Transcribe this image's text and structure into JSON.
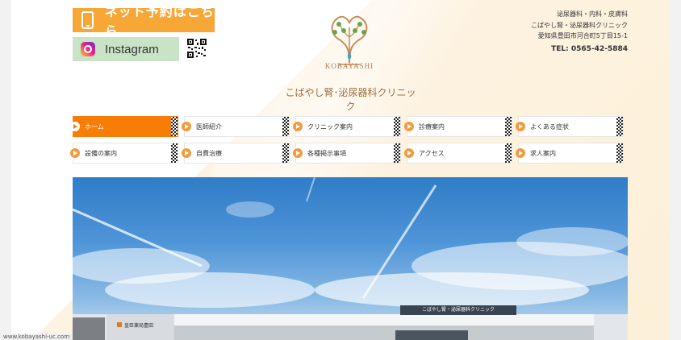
{
  "header": {
    "reserve_label": "ネット予約はこちら",
    "instagram_label": "Instagram",
    "logo_text": "KOBAYASHI",
    "clinic_name": "こばやし腎･泌尿器科クリニック",
    "address": {
      "line1": "泌尿器科・内科・皮膚科",
      "line2": "こばやし腎・泌尿器科クリニック",
      "line3": "愛知県豊田市河合町5丁目15-1",
      "tel": "TEL: 0565-42-5884"
    }
  },
  "nav": {
    "items": [
      {
        "label": "ホーム",
        "active": true
      },
      {
        "label": "医師紹介"
      },
      {
        "label": "クリニック案内"
      },
      {
        "label": "診療案内"
      },
      {
        "label": "よくある症状"
      },
      {
        "label": "設備の案内"
      },
      {
        "label": "自費治療"
      },
      {
        "label": "各種掲示事項"
      },
      {
        "label": "アクセス"
      },
      {
        "label": "求人案内"
      }
    ]
  },
  "hero": {
    "building_sign": "こばやし腎・泌尿器科クリニック",
    "side_sign": "皇臣薬局豊田"
  },
  "footer": {
    "url": "www.kobayashi-uc.com"
  },
  "colors": {
    "accent_orange": "#f77d06",
    "reserve_button": "#f7a735",
    "instagram_button": "#c8e3c6"
  }
}
